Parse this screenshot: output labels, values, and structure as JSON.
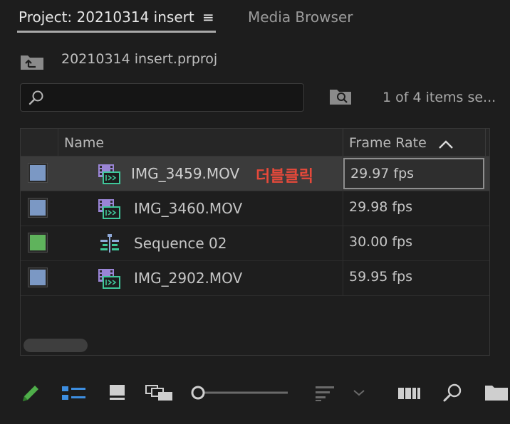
{
  "tabs": {
    "active_label": "Project: 20210314 insert",
    "menu_glyph": "≡",
    "inactive_label": "Media Browser"
  },
  "project": {
    "name": "20210314 insert.prproj"
  },
  "search": {
    "value": "",
    "placeholder": "",
    "items_count": "1 of 4 items se..."
  },
  "table": {
    "columns": [
      "Name",
      "Frame Rate"
    ],
    "sort": "ascending",
    "rows": [
      {
        "name": "IMG_3459.MOV",
        "frame_rate": "29.97 fps",
        "type": "clip",
        "label_color": "#7b98c4",
        "selected": true
      },
      {
        "name": "IMG_3460.MOV",
        "frame_rate": "29.98 fps",
        "type": "clip",
        "label_color": "#7b98c4",
        "selected": false
      },
      {
        "name": "Sequence 02",
        "frame_rate": "30.00 fps",
        "type": "sequence",
        "label_color": "#5fb35c",
        "selected": false
      },
      {
        "name": "IMG_2902.MOV",
        "frame_rate": "59.95 fps",
        "type": "clip",
        "label_color": "#7b98c4",
        "selected": false
      }
    ]
  },
  "annotation": {
    "text": "더블클릭",
    "color": "#e5493b"
  },
  "toolbar": {
    "icons": [
      "pencil-icon",
      "list-view-icon",
      "icon-view-icon",
      "freeform-view-icon",
      "zoom-slider",
      "sort-icon",
      "chevron-down-icon",
      "automate-to-sequence-icon",
      "find-icon",
      "new-bin-icon"
    ],
    "zoom_level": 0.0
  },
  "colors": {
    "accent_green": "#4fae4a",
    "accent_blue": "#3d8ee0",
    "clip_purple": "#9a85d6",
    "clip_green": "#3fc79a"
  }
}
